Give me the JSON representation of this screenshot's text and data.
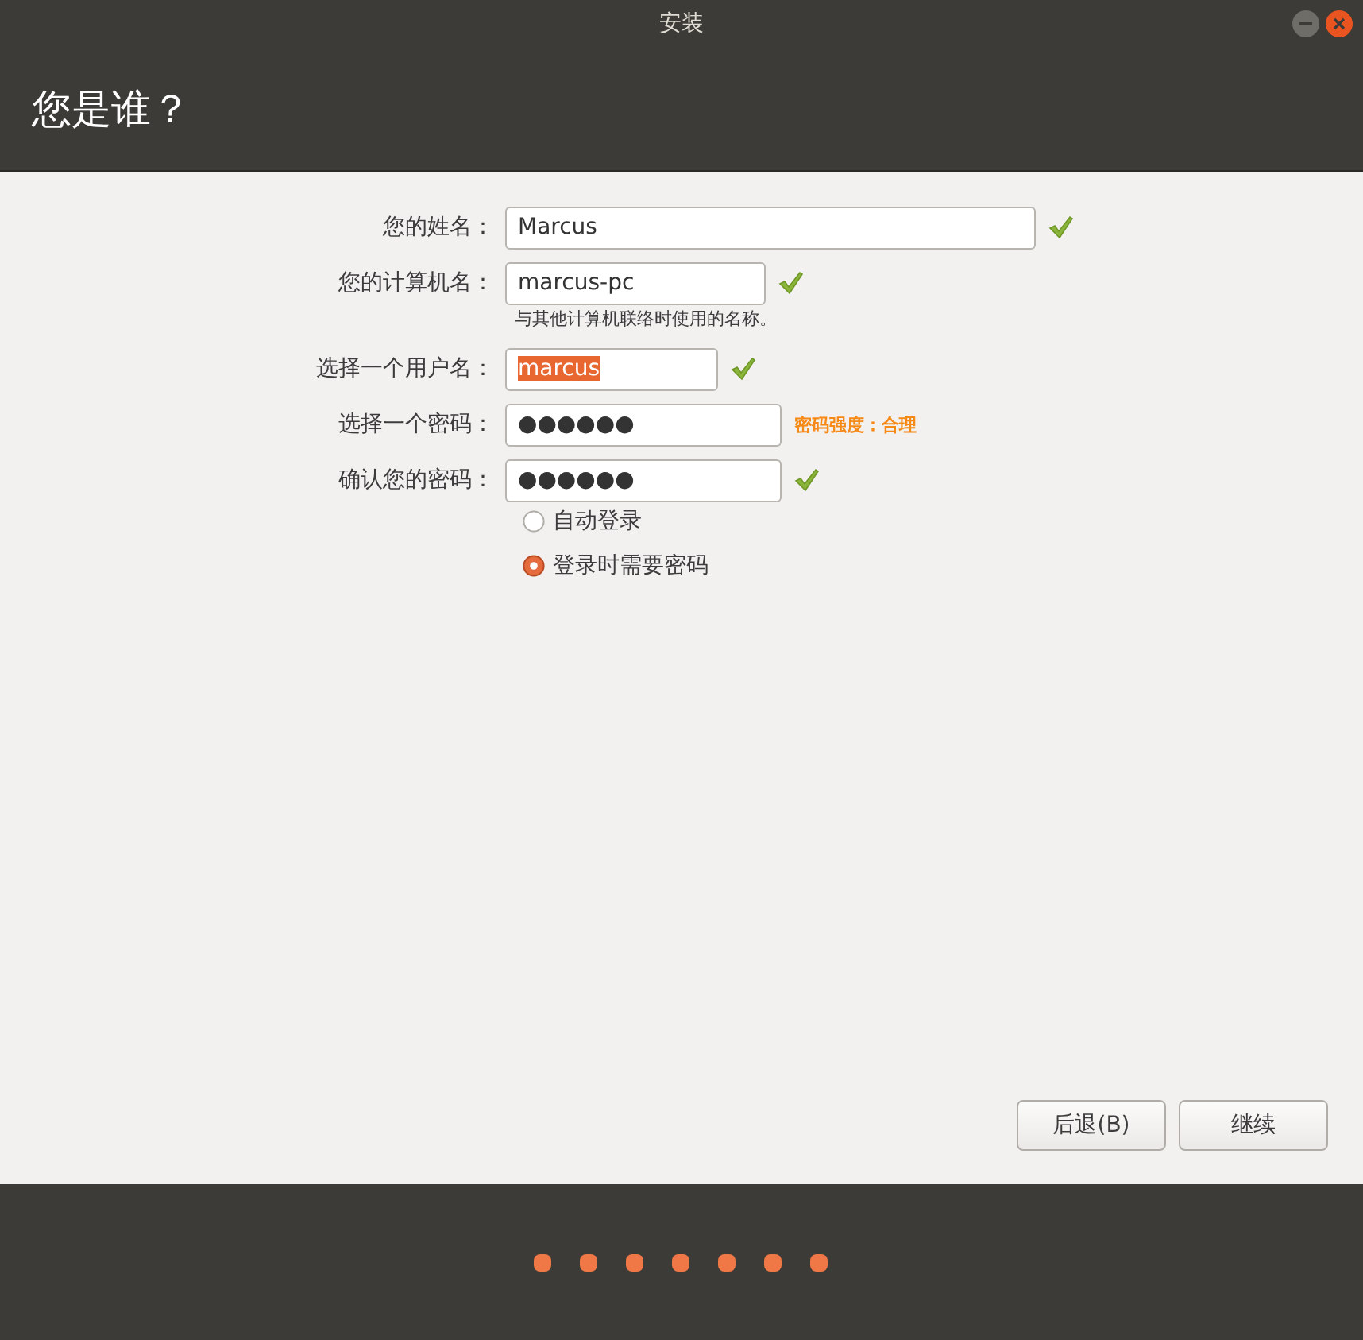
{
  "window": {
    "title": "安装"
  },
  "header": {
    "title": "您是谁？"
  },
  "fields": [
    {
      "label": "您的姓名：",
      "value": "Marcus",
      "valid": true,
      "text_selected": false
    },
    {
      "label": "您的计算机名：",
      "value": "marcus-pc",
      "valid": true,
      "text_selected": false,
      "hint": "与其他计算机联络时使用的名称。"
    },
    {
      "label": "选择一个用户名：",
      "value": "marcus",
      "valid": true,
      "text_selected": true
    },
    {
      "label": "选择一个密码：",
      "value": "●●●●●●",
      "valid": false,
      "text_selected": false,
      "strength": "密码强度：合理"
    },
    {
      "label": "确认您的密码：",
      "value": "●●●●●●",
      "valid": true,
      "text_selected": false
    }
  ],
  "login_options": [
    {
      "label": "自动登录",
      "selected": false
    },
    {
      "label": "登录时需要密码",
      "selected": true
    }
  ],
  "buttons": [
    {
      "label": "后退(B)"
    },
    {
      "label": "继续"
    }
  ]
}
